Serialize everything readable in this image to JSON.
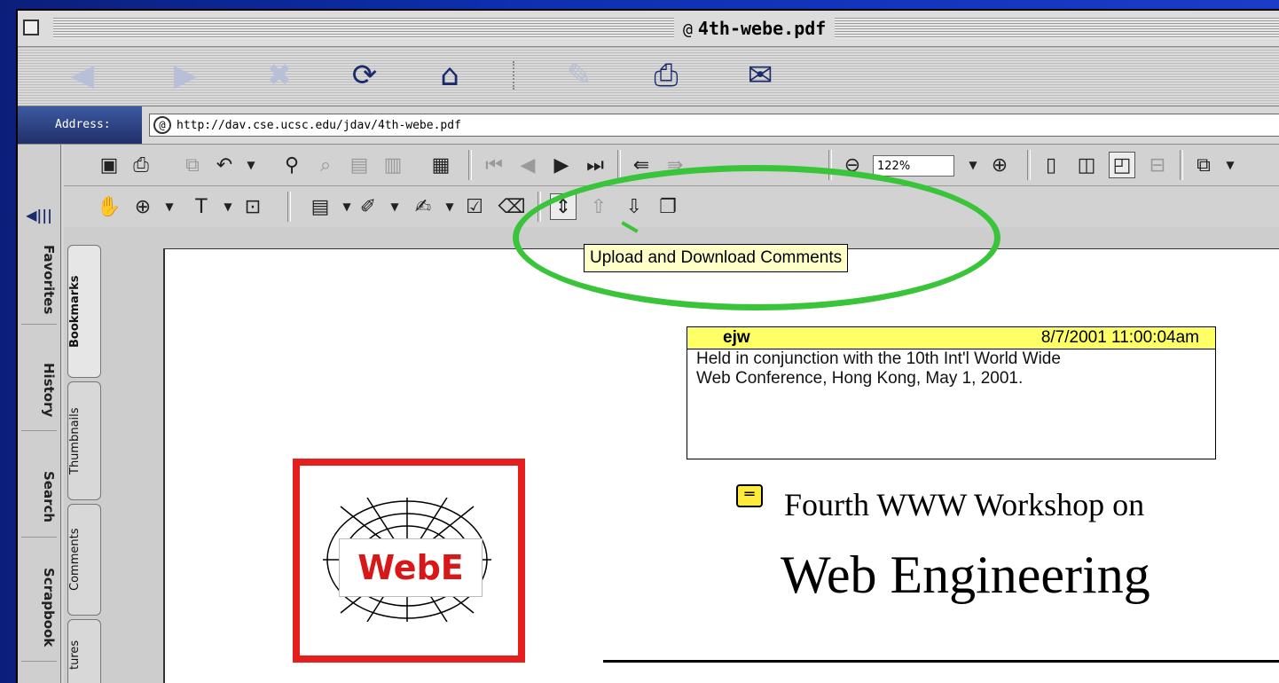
{
  "window": {
    "title": "4th-webe.pdf",
    "title_prefix_icon": "at-sign-icon"
  },
  "navigation": {
    "buttons": [
      {
        "name": "back-button",
        "icon": "left-arrow-icon",
        "enabled": false
      },
      {
        "name": "forward-button",
        "icon": "right-arrow-icon",
        "enabled": false
      },
      {
        "name": "stop-button",
        "icon": "x-icon",
        "enabled": false
      },
      {
        "name": "refresh-button",
        "icon": "refresh-icon",
        "enabled": true
      },
      {
        "name": "home-button",
        "icon": "home-icon",
        "enabled": true
      },
      {
        "name": "autofill-button",
        "icon": "pen-icon",
        "enabled": false
      },
      {
        "name": "print-button",
        "icon": "printer-icon",
        "enabled": true
      },
      {
        "name": "mail-button",
        "icon": "envelope-icon",
        "enabled": true
      }
    ]
  },
  "address": {
    "label": "Address:",
    "url": "http://dav.cse.ucsc.edu/jdav/4th-webe.pdf"
  },
  "sidebar": {
    "tabs": [
      "Favorites",
      "History",
      "Search",
      "Scrapbook"
    ]
  },
  "toolbar": {
    "zoom": "122%"
  },
  "doc_tabs": [
    "Bookmarks",
    "Thumbnails",
    "Comments",
    "tures"
  ],
  "tooltip": "Upload and Download Comments",
  "note": {
    "author": "ejw",
    "date": "8/7/2001 11:00:04am",
    "text": "Held in conjunction with the 10th Int'l World Wide\nWeb Conference, Hong Kong, May 1, 2001."
  },
  "logo": {
    "text": "WebE"
  },
  "document": {
    "heading_line1": "Fourth WWW Workshop on",
    "heading_line2": "Web Engineering"
  },
  "colors": {
    "highlight_ellipse": "#3ac43a",
    "note_header": "#ffff66",
    "logo_border": "#e51e1e",
    "tooltip_bg": "#ffffc8"
  }
}
